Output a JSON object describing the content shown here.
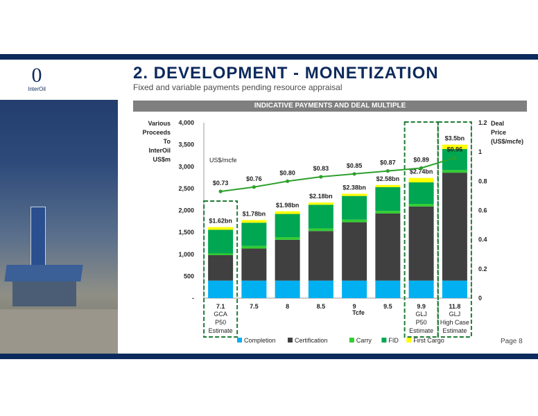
{
  "logo": {
    "glyph": "0",
    "text": "InterOil"
  },
  "page": {
    "title": "2. DEVELOPMENT -  MONETIZATION",
    "subtitle": "Fixed and variable payments pending resource appraisal",
    "banner": "INDICATIVE PAYMENTS AND DEAL MULTIPLE",
    "page_number": "Page 8"
  },
  "colors": {
    "navy": "#0d2a5c",
    "completion": "#00b0f0",
    "certification": "#404040",
    "carry": "#33cc33",
    "fid": "#00a651",
    "first_cargo": "#ffff00",
    "price_line": "#2ca02c",
    "highlight_box": "#1e7b34"
  },
  "chart_data": {
    "type": "bar",
    "stacked": true,
    "categories": [
      "7.1",
      "7.5",
      "8",
      "8.5",
      "9",
      "9.5",
      "9.9",
      "11.8"
    ],
    "category_sublabels": [
      [
        "GCA",
        "P50",
        "Estimate"
      ],
      [],
      [],
      [],
      [],
      [],
      [
        "GLJ",
        "P50",
        "Estimate"
      ],
      [
        "GLJ",
        "High Case",
        "Estimate"
      ]
    ],
    "xlabel": "Tcfe",
    "ylabel_left": [
      "Various",
      "Proceeds",
      "To",
      "InterOil",
      "US$m"
    ],
    "ylabel_right": [
      "Deal",
      "Price",
      "(US$/mcfe)"
    ],
    "ylim_left": [
      0,
      4000
    ],
    "yticks_left": [
      "-",
      "500",
      "1,000",
      "1,500",
      "2,000",
      "2,500",
      "3,000",
      "3,500",
      "4,000"
    ],
    "ylim_right": [
      0,
      1.2
    ],
    "yticks_right": [
      "0",
      "0.2",
      "0.4",
      "0.6",
      "0.8",
      "1",
      "1.2"
    ],
    "series": [
      {
        "name": "Completion",
        "values": [
          400,
          400,
          400,
          400,
          400,
          400,
          400,
          400
        ]
      },
      {
        "name": "Certification",
        "values": [
          580,
          730,
          930,
          1130,
          1330,
          1530,
          1690,
          2460
        ]
      },
      {
        "name": "Carry",
        "values": [
          40,
          60,
          60,
          60,
          60,
          60,
          60,
          60
        ]
      },
      {
        "name": "FID",
        "values": [
          540,
          530,
          530,
          540,
          540,
          540,
          490,
          480
        ]
      },
      {
        "name": "First Cargo",
        "values": [
          60,
          60,
          60,
          50,
          50,
          50,
          100,
          100
        ]
      }
    ],
    "totals_labels": [
      "$1.62bn",
      "$1.78bn",
      "$1.98bn",
      "$2.18bn",
      "$2.38bn",
      "$2.58bn",
      "$2.74bn",
      "$3.5bn"
    ],
    "deal_price": {
      "name": "US$/mcfe",
      "values": [
        0.73,
        0.76,
        0.8,
        0.83,
        0.85,
        0.87,
        0.89,
        0.96
      ],
      "labels": [
        "$0.73",
        "$0.76",
        "$0.80",
        "$0.83",
        "$0.85",
        "$0.87",
        "$0.89",
        "$0.96"
      ]
    },
    "highlighted_categories": [
      0,
      6,
      7
    ],
    "legend_position": "bottom"
  }
}
